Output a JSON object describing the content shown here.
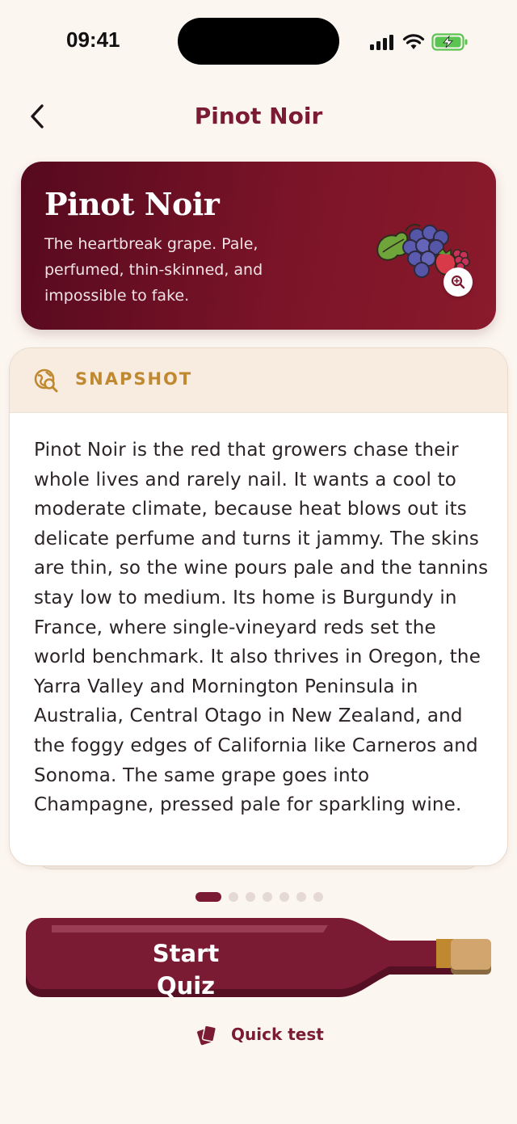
{
  "status_bar": {
    "time": "09:41"
  },
  "nav": {
    "title": "Pinot Noir"
  },
  "hero": {
    "title": "Pinot Noir",
    "description": "The heartbreak grape. Pale, perfumed, thin-skinned, and impossible to fake."
  },
  "snapshot": {
    "label": "SNAPSHOT",
    "body": "Pinot Noir is the red that growers chase their whole lives and rarely nail. It wants a cool to moderate climate, because heat blows out its delicate perfume and turns it jammy. The skins are thin, so the wine pours pale and the tannins stay low to medium. Its home is Burgundy in France, where single-vineyard reds set the world benchmark. It also thrives in Oregon, the Yarra Valley and Mornington Peninsula in Australia, Central Otago in New Zealand, and the foggy edges of California like Carneros and Sonoma. The same grape goes into Champagne, pressed pale for sparkling wine."
  },
  "pager": {
    "total": 7,
    "active_index": 0
  },
  "actions": {
    "start_quiz_label": "Start Quiz",
    "quick_test_label": "Quick test"
  },
  "colors": {
    "brand": "#7b1a33",
    "accent_gold": "#c08930",
    "background": "#fcf6f0"
  },
  "icons": {
    "back": "chevron-left-icon",
    "snapshot": "globe-search-icon",
    "zoom": "zoom-in-icon",
    "quick_test": "cards-icon"
  }
}
